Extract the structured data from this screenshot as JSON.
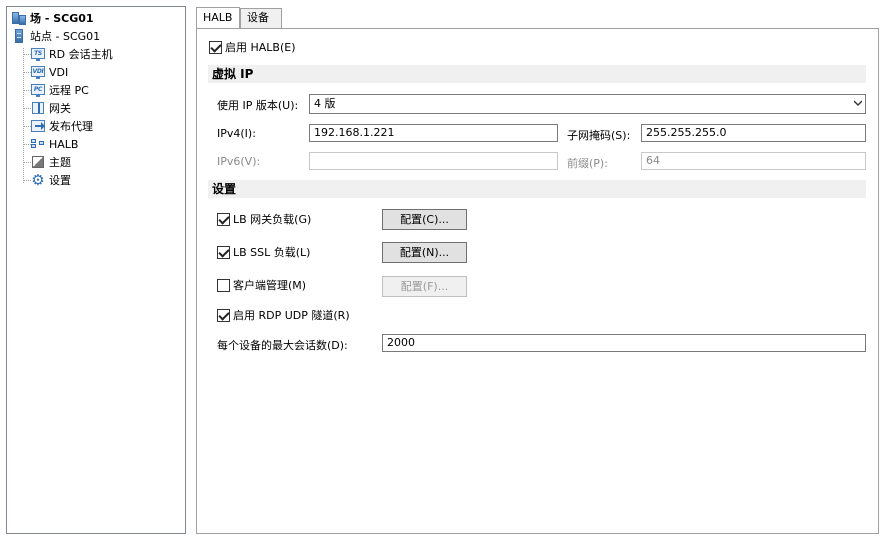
{
  "tree": {
    "items": [
      {
        "label": "场 - SCG01",
        "icon": "farm-icon"
      },
      {
        "label": "站点 - SCG01",
        "icon": "server-icon"
      },
      {
        "label": "RD 会话主机",
        "icon": "ts-icon"
      },
      {
        "label": "VDI",
        "icon": "vdi-icon"
      },
      {
        "label": "远程 PC",
        "icon": "pc-icon"
      },
      {
        "label": "网关",
        "icon": "gateway-icon"
      },
      {
        "label": "发布代理",
        "icon": "broker-icon"
      },
      {
        "label": "HALB",
        "icon": "halb-icon"
      },
      {
        "label": "主题",
        "icon": "theme-icon"
      },
      {
        "label": "设置",
        "icon": "gear-icon"
      }
    ],
    "ts_badge": "TS",
    "vdi_badge": "VDI",
    "pc_badge": "PC"
  },
  "tabs": [
    {
      "label": "HALB",
      "active": true
    },
    {
      "label": "设备",
      "active": false
    }
  ],
  "halb": {
    "enable_label": "启用 HALB(E)",
    "enable_checked": true,
    "virtual_ip_header": "虚拟 IP",
    "ip_version_label": "使用 IP 版本(U):",
    "ip_version_value": "4 版",
    "ipv4_label": "IPv4(I):",
    "ipv4_value": "192.168.1.221",
    "subnet_label": "子网掩码(S):",
    "subnet_value": "255.255.255.0",
    "ipv6_label": "IPv6(V):",
    "ipv6_value": "",
    "prefix_label": "前缀(P):",
    "prefix_value": "64",
    "settings_header": "设置",
    "lb_gateway_label": "LB 网关负载(G)",
    "lb_gateway_checked": true,
    "lb_gateway_button": "配置(C)...",
    "lb_ssl_label": "LB SSL 负载(L)",
    "lb_ssl_checked": true,
    "lb_ssl_button": "配置(N)...",
    "client_mgmt_label": "客户端管理(M)",
    "client_mgmt_checked": false,
    "client_mgmt_button": "配置(F)...",
    "rdp_udp_label": "启用 RDP UDP 隧道(R)",
    "rdp_udp_checked": true,
    "max_sessions_label": "每个设备的最大会话数(D):",
    "max_sessions_value": "2000"
  }
}
